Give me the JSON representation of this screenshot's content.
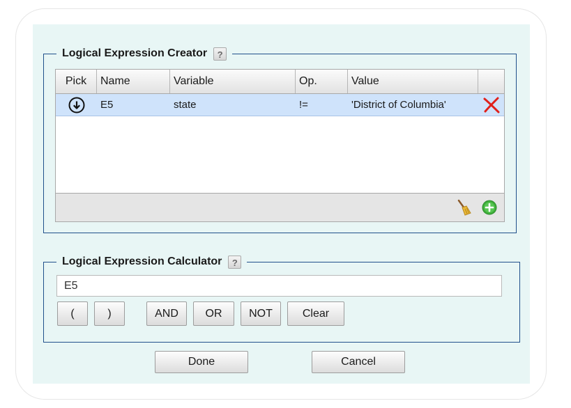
{
  "creator": {
    "title": "Logical Expression Creator",
    "help": "?",
    "columns": [
      "Pick",
      "Name",
      "Variable",
      "Op.",
      "Value",
      ""
    ],
    "rows": [
      {
        "name": "E5",
        "variable": "state",
        "op": "!=",
        "value": "'District of Columbia'"
      }
    ],
    "icons": {
      "pick": "circle-down-arrow-icon",
      "delete": "red-x-icon",
      "clear": "broom-icon",
      "add": "green-plus-icon"
    }
  },
  "calculator": {
    "title": "Logical Expression Calculator",
    "help": "?",
    "expression": "E5",
    "buttons": {
      "open_paren": "(",
      "close_paren": ")",
      "and": "AND",
      "or": "OR",
      "not": "NOT",
      "clear": "Clear"
    }
  },
  "dialog": {
    "done": "Done",
    "cancel": "Cancel"
  },
  "colors": {
    "panel_bg": "#e8f6f5",
    "fieldset_border": "#1f4f8a",
    "selected_row": "#cfe3fb",
    "delete_red": "#e0201a",
    "add_green": "#3fae3a"
  }
}
